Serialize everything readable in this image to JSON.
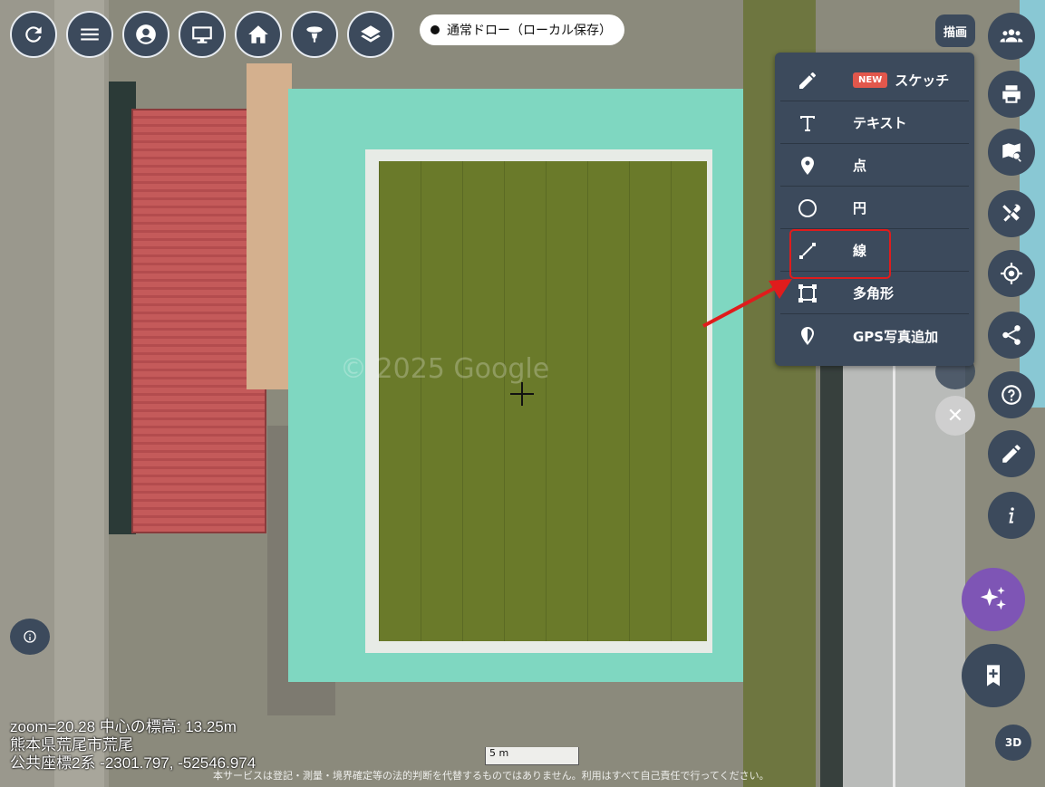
{
  "toolbar": {
    "buttons": [
      {
        "name": "reload-icon"
      },
      {
        "name": "menu-icon"
      },
      {
        "name": "account-icon"
      },
      {
        "name": "monitor-icon"
      },
      {
        "name": "home-icon"
      },
      {
        "name": "street-view-icon"
      },
      {
        "name": "layers-icon"
      }
    ]
  },
  "mode_pill": {
    "label": "通常ドロー（ローカル保存）"
  },
  "draw_tag": {
    "label": "描画"
  },
  "draw_menu": {
    "items": [
      {
        "icon": "pencil-icon",
        "label": "スケッチ",
        "badge": "NEW"
      },
      {
        "icon": "text-icon",
        "label": "テキスト"
      },
      {
        "icon": "pin-icon",
        "label": "点"
      },
      {
        "icon": "circle-icon",
        "label": "円"
      },
      {
        "icon": "line-icon",
        "label": "線",
        "highlighted": true
      },
      {
        "icon": "polygon-icon",
        "label": "多角形"
      },
      {
        "icon": "gps-photo-icon",
        "label": "GPS写真追加"
      }
    ]
  },
  "right_buttons": [
    {
      "name": "users-icon"
    },
    {
      "name": "print-icon"
    },
    {
      "name": "map-search-icon"
    },
    {
      "name": "tools-icon"
    },
    {
      "name": "locate-icon"
    },
    {
      "name": "share-icon"
    },
    {
      "name": "help-icon"
    },
    {
      "name": "edit-icon"
    },
    {
      "name": "info-icon"
    }
  ],
  "fab": {
    "three_d_label": "3D"
  },
  "status": {
    "line1": "zoom=20.28 中心の標高: 13.25m",
    "line2": "熊本県荒尾市荒尾",
    "line3": "公共座標2系 -2301.797, -52546.974"
  },
  "scale_label": "5 m",
  "watermark": "© 2025 Google",
  "disclaimer": "本サービスは登記・測量・境界確定等の法的判断を代替するものではありません。利用はすべて自己責任で行ってください。",
  "colors": {
    "panel": "#3c4a5c",
    "highlight": "#e01c1c",
    "ai_fab": "#7e55b5",
    "badge": "#e2574c"
  }
}
